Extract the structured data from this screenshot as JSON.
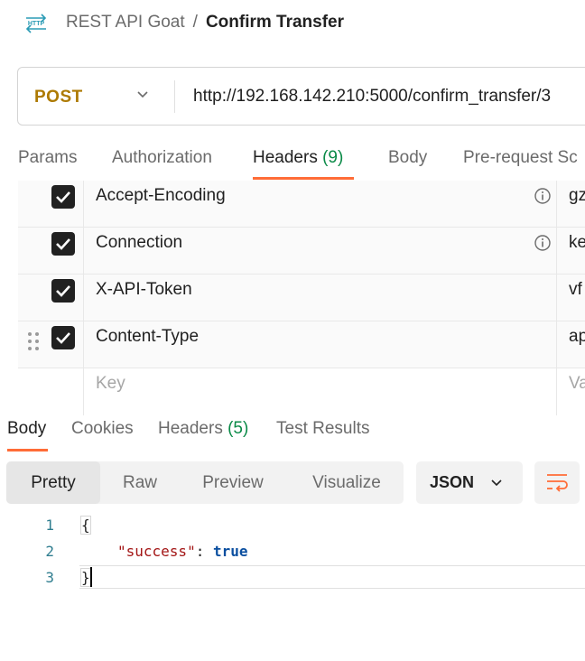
{
  "header": {
    "icon_text": "HTTP",
    "collection": "REST API Goat",
    "separator": "/",
    "request_name": "Confirm Transfer"
  },
  "url_bar": {
    "method": "POST",
    "url": "http://192.168.142.210:5000/confirm_transfer/3"
  },
  "request_tabs": [
    {
      "label": "Params",
      "count": ""
    },
    {
      "label": "Authorization",
      "count": ""
    },
    {
      "label": "Headers",
      "count": "(9)"
    },
    {
      "label": "Body",
      "count": ""
    },
    {
      "label": "Pre-request Sc",
      "count": ""
    }
  ],
  "headers_table": {
    "rows": [
      {
        "key": "Accept-Encoding",
        "value": "gz",
        "checked": true
      },
      {
        "key": "Connection",
        "value": "ke",
        "checked": true
      },
      {
        "key": "X-API-Token",
        "value": "vf",
        "checked": true
      },
      {
        "key": "Content-Type",
        "value": "ap",
        "checked": true
      }
    ],
    "key_placeholder": "Key",
    "value_placeholder": "Va"
  },
  "response_tabs": [
    {
      "label": "Body",
      "count": ""
    },
    {
      "label": "Cookies",
      "count": ""
    },
    {
      "label": "Headers",
      "count": "(5)"
    },
    {
      "label": "Test Results",
      "count": ""
    }
  ],
  "view_modes": [
    "Pretty",
    "Raw",
    "Preview",
    "Visualize"
  ],
  "format": "JSON",
  "code": {
    "line_numbers": [
      "1",
      "2",
      "3"
    ],
    "open_brace": "{",
    "key": "\"success\"",
    "colon": ": ",
    "value": "true",
    "close_brace": "}"
  },
  "colors": {
    "accent": "#ff6c37",
    "method_post": "#ad7a03",
    "count_green": "#0a8a47"
  }
}
